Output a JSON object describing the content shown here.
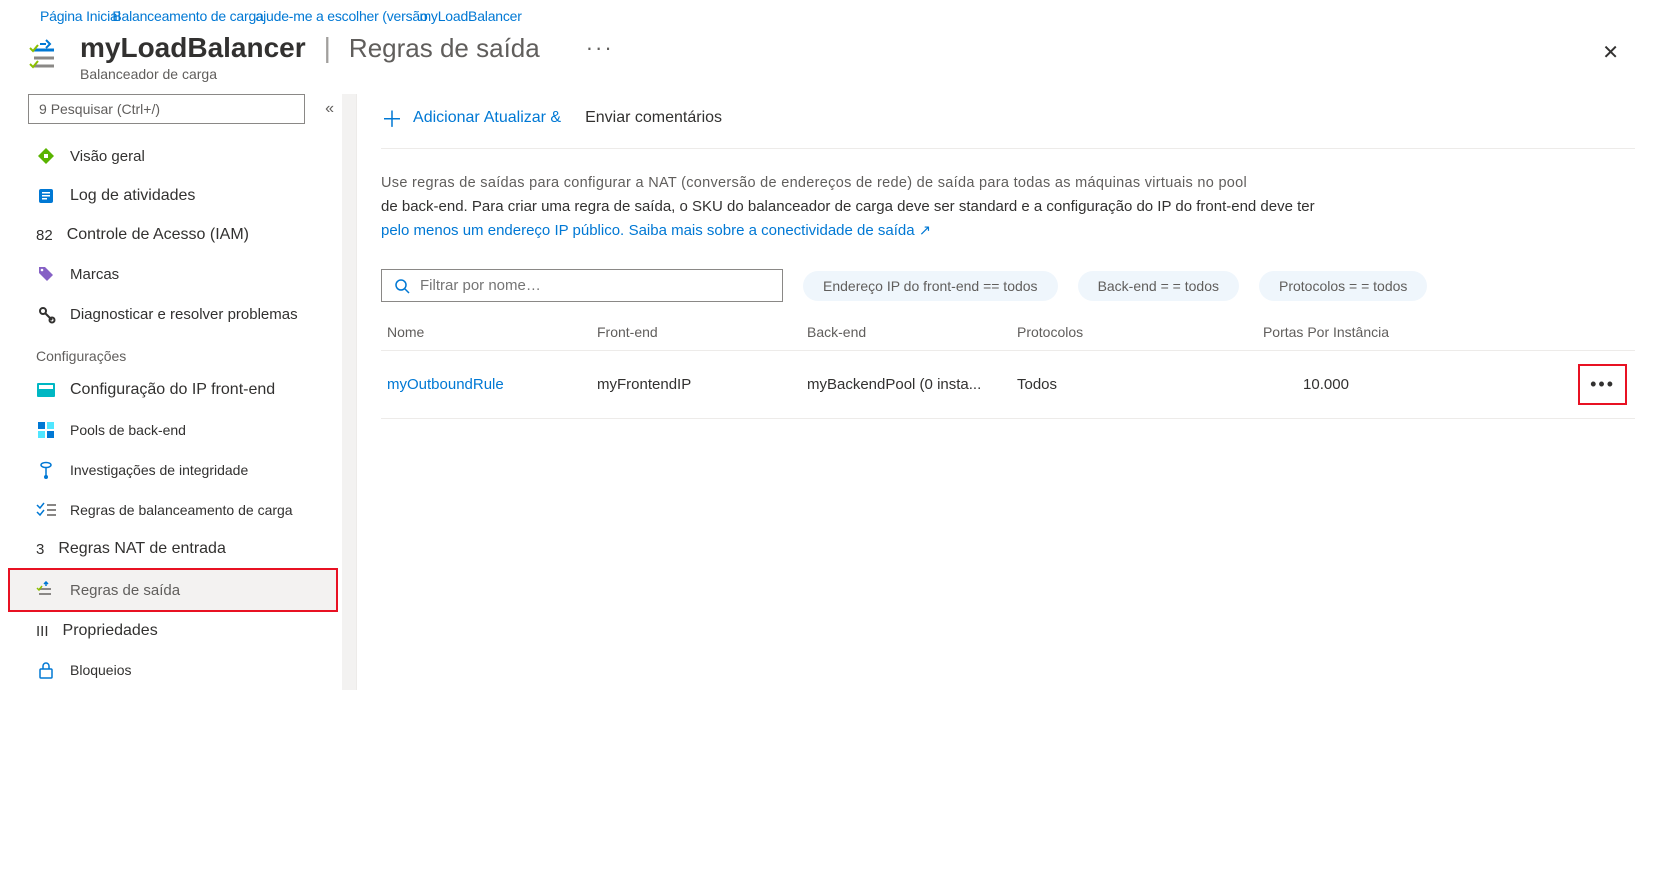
{
  "breadcrumbs": [
    "Página Inicial",
    "Balanceamento de carga",
    "ajude-me a escolher (versão",
    "myLoadBalancer"
  ],
  "header": {
    "title": "myLoadBalancer",
    "section": "Regras de saída",
    "subtitle": "Balanceador de carga",
    "more": "···",
    "close": "✕"
  },
  "sidebar": {
    "search_placeholder": "Pesquisar (Ctrl+/)",
    "search_prefix": "9",
    "collapse": "«",
    "items_top": [
      {
        "label": "Visão geral",
        "icon": "overview"
      },
      {
        "label": "Log de atividades",
        "icon": "activity"
      },
      {
        "label": "Controle de Acesso (IAM)",
        "icon": "iam",
        "prefix": "82"
      },
      {
        "label": "Marcas",
        "icon": "tags"
      },
      {
        "label": "Diagnosticar e resolver problemas",
        "icon": "diagnose"
      }
    ],
    "section_settings": "Configurações",
    "items_settings": [
      {
        "label": "Configuração do IP front-end",
        "icon": "frontend"
      },
      {
        "label": "Pools de back-end",
        "icon": "backend"
      },
      {
        "label": "Investigações de integridade",
        "icon": "health"
      },
      {
        "label": "Regras de balanceamento de carga",
        "icon": "lbrules"
      },
      {
        "label": "Regras NAT de entrada",
        "icon": "nat",
        "prefix": "3"
      },
      {
        "label": "Regras de saída",
        "icon": "outbound",
        "selected": true
      },
      {
        "label": "Propriedades",
        "icon": "properties",
        "prefix": "III"
      },
      {
        "label": "Bloqueios",
        "icon": "locks"
      }
    ]
  },
  "toolbar": {
    "add": "Adicionar",
    "refresh": "Atualizar &",
    "feedback": "Enviar comentários"
  },
  "description": {
    "line1": "Use regras de saídas para configurar a NAT (conversão de endereços de rede) de saída para todas as máquinas virtuais no pool",
    "line2": "de back-end. Para criar uma regra de saída, o SKU do balanceador de carga deve ser standard e a configuração do IP do front-end deve ter",
    "link1": "pelo menos um endereço IP público.",
    "link2": "Saiba mais sobre a conectividade de saída"
  },
  "filters": {
    "name_placeholder": "Filtrar por nome…",
    "pill_frontend": "Endereço IP do front-end ==  todos",
    "pill_backend": "Back-end =   =  todos",
    "pill_protocol": "Protocolos =  =  todos"
  },
  "table": {
    "headers": {
      "name": "Nome",
      "frontend": "Front-end",
      "backend": "Back-end",
      "protocol": "Protocolos",
      "ports": "Portas Por Instância"
    },
    "rows": [
      {
        "name": "myOutboundRule",
        "frontend": "myFrontendIP",
        "backend": "myBackendPool (0 insta...",
        "protocol": "Todos",
        "ports": "10.000"
      }
    ]
  }
}
